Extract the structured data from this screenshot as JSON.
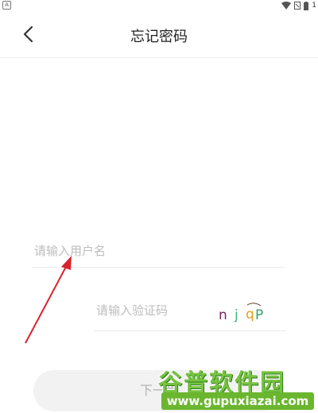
{
  "status_bar": {
    "left_icon": "A",
    "time_fragment": "1",
    "icons": [
      "wifi-icon",
      "sim-icon",
      "battery-icon"
    ]
  },
  "header": {
    "title": "忘记密码",
    "back_icon": "chevron-left-icon"
  },
  "form": {
    "username_placeholder": "请输入用户名",
    "code_placeholder": "请输入验证码",
    "captcha": {
      "chars": [
        "n",
        "j",
        "q",
        "P"
      ],
      "colors": [
        "#7a1f5c",
        "#3fb37f",
        "#e0a020",
        "#33a06f"
      ]
    },
    "next_button_label": "下一步"
  },
  "annotation": {
    "arrow_color": "#d9232f"
  },
  "watermark": {
    "title": "谷普软件园",
    "url": "www.gupuxiazai.com",
    "color": "#6ab62f"
  }
}
